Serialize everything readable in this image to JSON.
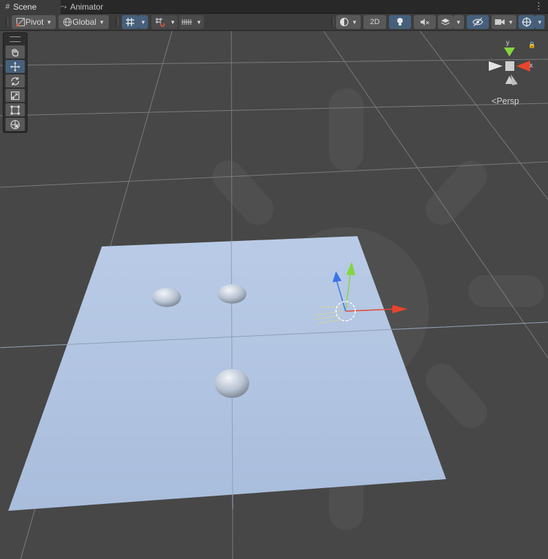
{
  "tabs": [
    {
      "label": "Scene",
      "icon": "grid-icon",
      "active": true
    },
    {
      "label": "Animator",
      "icon": "animator-icon",
      "active": false
    }
  ],
  "toolbar": {
    "pivot_label": "Pivot",
    "global_label": "Global",
    "mode_2d_label": "2D"
  },
  "tools": [
    {
      "name": "hand-tool",
      "icon": "hand-icon",
      "active": false
    },
    {
      "name": "move-tool",
      "icon": "move-icon",
      "active": true
    },
    {
      "name": "rotate-tool",
      "icon": "rotate-icon",
      "active": false
    },
    {
      "name": "scale-tool",
      "icon": "scale-icon",
      "active": false
    },
    {
      "name": "rect-tool",
      "icon": "rect-icon",
      "active": false
    },
    {
      "name": "transform-tool",
      "icon": "transform-icon",
      "active": false
    }
  ],
  "gizmo": {
    "y_label": "y",
    "x_label": "x",
    "projection_label": "Persp"
  },
  "colors": {
    "background": "#474747",
    "plane": "#b3c7e4",
    "axis_x": "#e8442f",
    "axis_y": "#84d63f",
    "axis_z": "#3b73e8",
    "accent": "#46607c"
  }
}
